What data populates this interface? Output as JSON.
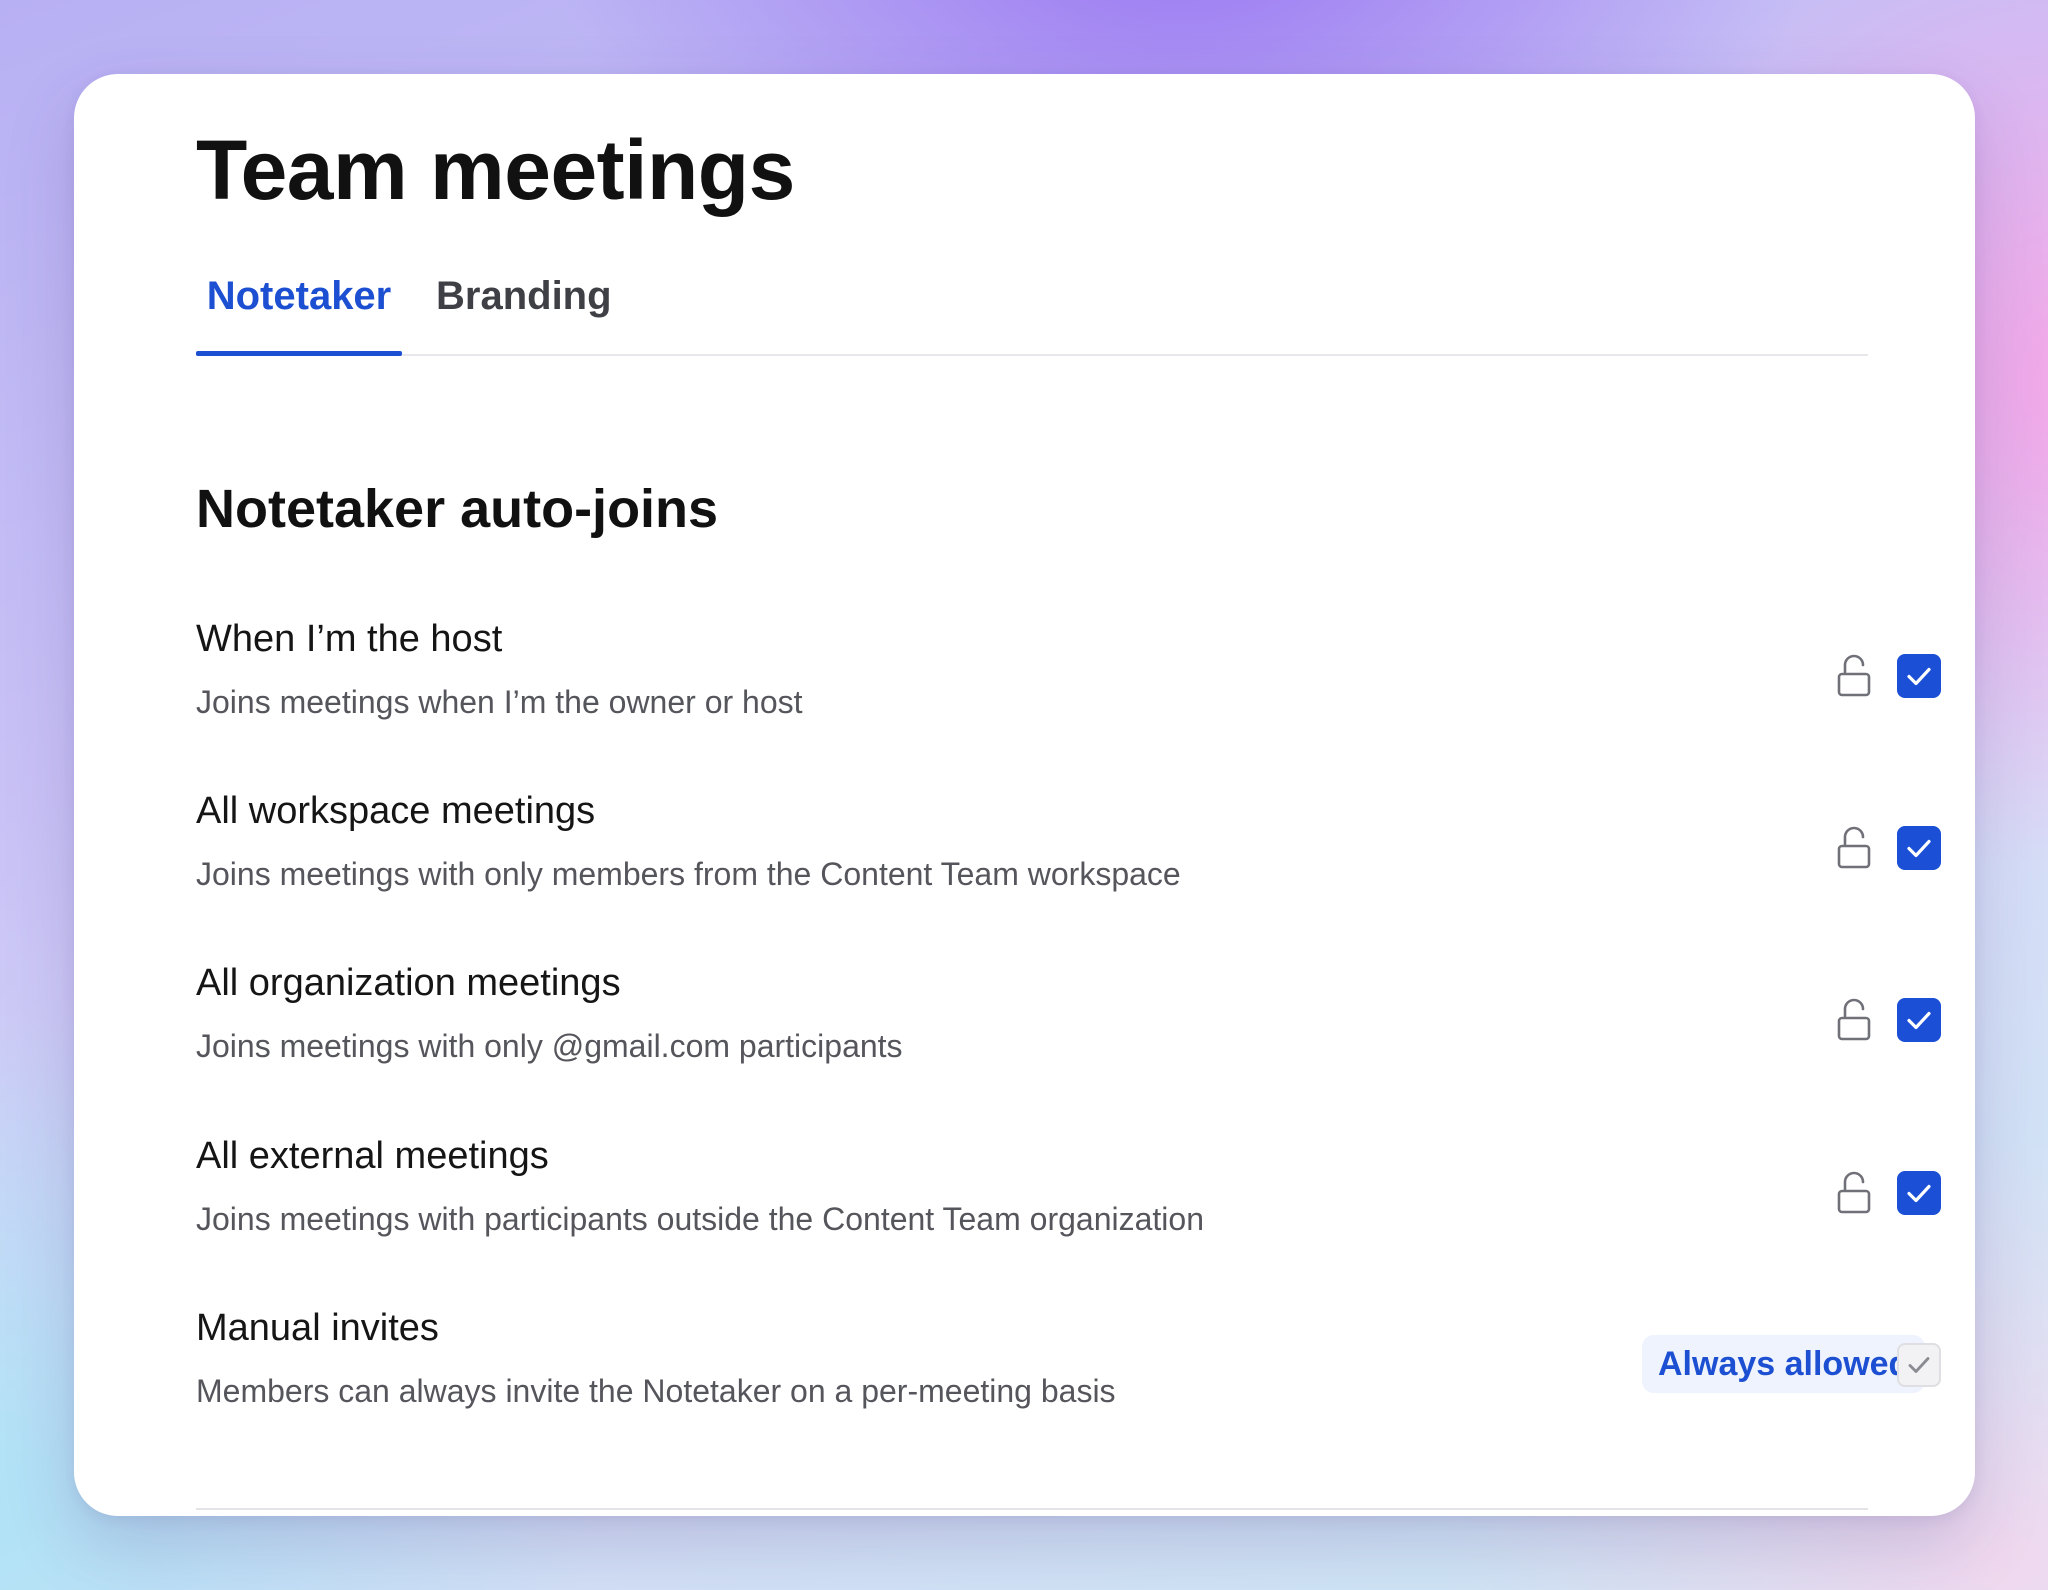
{
  "page": {
    "title": "Team meetings"
  },
  "tabs": [
    {
      "label": "Notetaker",
      "active": true
    },
    {
      "label": "Branding",
      "active": false
    }
  ],
  "section": {
    "title": "Notetaker auto-joins"
  },
  "settings": [
    {
      "title": "When I’m the host",
      "description": "Joins meetings when I’m the owner or host",
      "lock_icon": "unlock-icon",
      "checked": true
    },
    {
      "title": "All workspace meetings",
      "description": "Joins meetings with only members from the Content Team workspace",
      "lock_icon": "unlock-icon",
      "checked": true
    },
    {
      "title": "All organization meetings",
      "description": "Joins meetings with only @gmail.com participants",
      "lock_icon": "unlock-icon",
      "checked": true
    },
    {
      "title": "All external meetings",
      "description": "Joins meetings with participants outside the Content Team organization",
      "lock_icon": "unlock-icon",
      "checked": true
    },
    {
      "title": "Manual invites",
      "description": "Members can always invite the Notetaker on a per-meeting basis",
      "badge": "Always allowed",
      "checked": true,
      "disabled": true
    }
  ],
  "colors": {
    "accent": "#1c4fd1",
    "checkbox_on": "#1a4fd6",
    "badge_bg": "#eef3fd",
    "text_primary": "#111111",
    "text_secondary": "#55555c"
  }
}
